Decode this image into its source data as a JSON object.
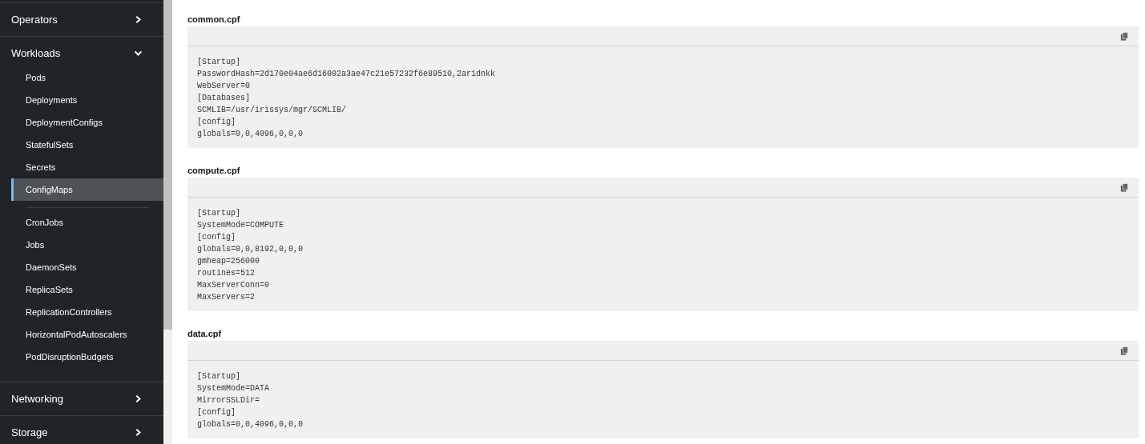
{
  "sidebar": {
    "sections": [
      {
        "label": "Operators",
        "expanded": false
      },
      {
        "label": "Workloads",
        "expanded": true,
        "groups": [
          [
            {
              "label": "Pods",
              "selected": false
            },
            {
              "label": "Deployments",
              "selected": false
            },
            {
              "label": "DeploymentConfigs",
              "selected": false
            },
            {
              "label": "StatefulSets",
              "selected": false
            },
            {
              "label": "Secrets",
              "selected": false
            },
            {
              "label": "ConfigMaps",
              "selected": true
            }
          ],
          [
            {
              "label": "CronJobs",
              "selected": false
            },
            {
              "label": "Jobs",
              "selected": false
            },
            {
              "label": "DaemonSets",
              "selected": false
            },
            {
              "label": "ReplicaSets",
              "selected": false
            },
            {
              "label": "ReplicationControllers",
              "selected": false
            },
            {
              "label": "HorizontalPodAutoscalers",
              "selected": false
            },
            {
              "label": "PodDisruptionBudgets",
              "selected": false
            }
          ]
        ]
      },
      {
        "label": "Networking",
        "expanded": false
      },
      {
        "label": "Storage",
        "expanded": false
      }
    ]
  },
  "files": [
    {
      "name": "common.cpf",
      "lines": [
        "[Startup]",
        "PasswordHash=2d170e04ae6d16002a3ae47c21e57232f6e89510,2ar1dnkk",
        "WebServer=0",
        "[Databases]",
        "SCMLIB=/usr/irissys/mgr/SCMLIB/",
        "[config]",
        "globals=0,0,4096,0,0,0"
      ]
    },
    {
      "name": "compute.cpf",
      "lines": [
        "[Startup]",
        "SystemMode=COMPUTE",
        "[config]",
        "globals=0,0,8192,0,0,0",
        "gmheap=256000",
        "routines=512",
        "MaxServerConn=0",
        "MaxServers=2"
      ]
    },
    {
      "name": "data.cpf",
      "lines": [
        "[Startup]",
        "SystemMode=DATA",
        "MirrorSSLDir=",
        "[config]",
        "globals=0,0,4096,0,0,0"
      ]
    }
  ]
}
